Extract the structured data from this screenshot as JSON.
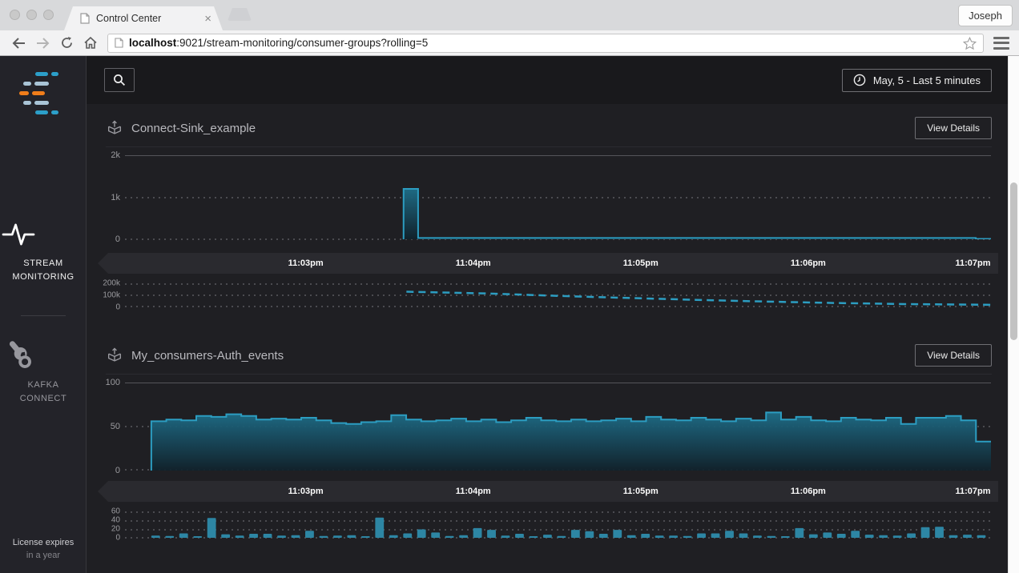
{
  "browser": {
    "tab_title": "Control Center",
    "tab_close_glyph": "×",
    "profile_name": "Joseph",
    "url_host": "localhost",
    "url_rest": ":9021/stream-monitoring/consumer-groups?rolling=5"
  },
  "sidebar": {
    "items": [
      {
        "icon": "pulse-icon",
        "label_line1": "STREAM",
        "label_line2": "MONITORING",
        "active": true
      },
      {
        "icon": "wrench-icon",
        "label_line1": "KAFKA",
        "label_line2": "CONNECT",
        "active": false
      }
    ],
    "license_line1": "License expires",
    "license_line2": "in a year"
  },
  "toolbar": {
    "time_range_label": "May, 5 - Last 5 minutes"
  },
  "view_details_label": "View Details",
  "icons": [
    "search-icon",
    "clock-icon",
    "consumer-group-box-icon",
    "pulse-icon",
    "wrench-icon",
    "star-icon",
    "menu-icon",
    "back-icon",
    "forward-icon",
    "reload-icon",
    "home-icon",
    "page-icon"
  ],
  "colors": {
    "accent_teal": "#2c9dc1",
    "logo_orange": "#f07d1a",
    "logo_light_blue": "#a9c4d6",
    "logo_blue": "#2c9fc9",
    "panel_dark": "#1f1f23",
    "axis_band": "#2a2a2f"
  },
  "xticks": [
    "11:03pm",
    "11:04pm",
    "11:05pm",
    "11:06pm",
    "11:07pm"
  ],
  "chart_data": [
    {
      "type": "area",
      "title": "Connect-Sink_example",
      "main": {
        "type": "step-area",
        "ylim": [
          0,
          2000
        ],
        "yticks": [
          "2k",
          "1k",
          "0"
        ],
        "comment": "single spike ~1200 just before 11:04pm, then flat ~30 to right edge, small drop near 11:07pm",
        "points": [
          [
            0.3217,
            0
          ],
          [
            0.3217,
            1200
          ],
          [
            0.3385,
            1200
          ],
          [
            0.3385,
            30
          ],
          [
            0.9825,
            30
          ],
          [
            0.9825,
            10
          ],
          [
            1.0,
            10
          ]
        ]
      },
      "mini": {
        "type": "dashed-line",
        "ylim": [
          0,
          200000
        ],
        "yticks": [
          "200k",
          "100k",
          "0"
        ],
        "points_k": [
          [
            0.325,
            130
          ],
          [
            0.42,
            115
          ],
          [
            0.5,
            95
          ],
          [
            0.58,
            78
          ],
          [
            0.66,
            62
          ],
          [
            0.74,
            48
          ],
          [
            0.82,
            36
          ],
          [
            0.9,
            27
          ],
          [
            1.0,
            21
          ]
        ]
      }
    },
    {
      "type": "step-area",
      "title": "My_consumers-Auth_events",
      "main": {
        "type": "step-area",
        "ylim": [
          0,
          100
        ],
        "yticks": [
          "100",
          "50",
          "0"
        ],
        "x_start": 0.0304,
        "values": [
          56,
          58,
          57,
          62,
          61,
          64,
          62,
          58,
          59,
          58,
          60,
          57,
          54,
          53,
          55,
          56,
          63,
          58,
          56,
          57,
          59,
          56,
          58,
          55,
          57,
          60,
          57,
          56,
          58,
          56,
          57,
          59,
          56,
          61,
          58,
          57,
          60,
          58,
          56,
          59,
          57,
          66,
          58,
          61,
          57,
          56,
          60,
          58,
          57,
          60,
          53,
          60,
          60,
          62,
          57,
          33
        ]
      },
      "mini": {
        "type": "bars",
        "ylim": [
          0,
          60
        ],
        "yticks": [
          "60",
          "40",
          "20",
          "0"
        ],
        "x_start": 0.0304,
        "values": [
          5,
          4,
          10,
          3,
          45,
          8,
          5,
          9,
          9,
          5,
          6,
          16,
          4,
          5,
          6,
          3,
          46,
          6,
          10,
          19,
          12,
          4,
          6,
          22,
          18,
          5,
          9,
          3,
          7,
          4,
          18,
          15,
          9,
          18,
          6,
          9,
          5,
          5,
          4,
          10,
          10,
          16,
          10,
          5,
          4,
          3,
          22,
          8,
          12,
          9,
          16,
          7,
          6,
          5,
          10,
          24,
          25,
          6,
          7,
          6
        ]
      }
    }
  ]
}
